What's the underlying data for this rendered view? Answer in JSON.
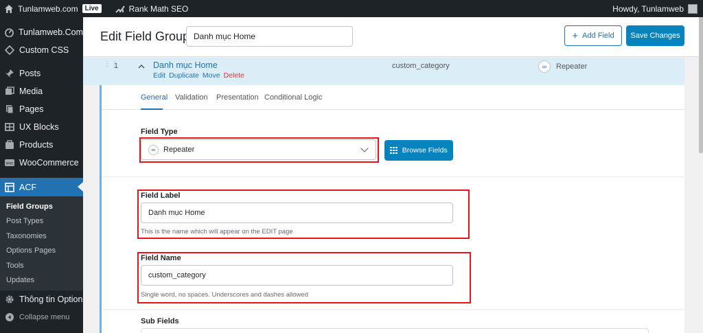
{
  "admin_bar": {
    "site_name": "Tunlamweb.com",
    "live_badge": "Live",
    "seo_plugin": "Rank Math SEO",
    "greeting": "Howdy, Tunlamweb"
  },
  "sidebar": {
    "items_top": [
      {
        "label": "Tunlamweb.Com",
        "icon": "dashboard-icon"
      },
      {
        "label": "Custom CSS",
        "icon": "diamond-icon"
      },
      {
        "label": "Posts",
        "icon": "pin-icon"
      },
      {
        "label": "Media",
        "icon": "media-icon"
      },
      {
        "label": "Pages",
        "icon": "pages-icon"
      },
      {
        "label": "UX Blocks",
        "icon": "blocks-icon"
      },
      {
        "label": "Products",
        "icon": "products-icon"
      },
      {
        "label": "WooCommerce",
        "icon": "woo-icon"
      }
    ],
    "acf": {
      "label": "ACF",
      "icon": "acf-icon"
    },
    "submenu": [
      "Field Groups",
      "Post Types",
      "Taxonomies",
      "Options Pages",
      "Tools",
      "Updates"
    ],
    "thong_tin": {
      "label": "Thông tin Option",
      "icon": "gear-icon"
    },
    "collapse": {
      "label": "Collapse menu",
      "icon": "collapse-icon"
    }
  },
  "header": {
    "title": "Edit Field Group",
    "group_title_value": "Danh mục Home",
    "add_field": "Add Field",
    "save_changes": "Save Changes"
  },
  "field_row": {
    "order": "1",
    "label": "Danh mục Home",
    "actions": {
      "edit": "Edit",
      "duplicate": "Duplicate",
      "move": "Move",
      "delete": "Delete"
    },
    "name": "custom_category",
    "type": "Repeater"
  },
  "tabs": [
    "General",
    "Validation",
    "Presentation",
    "Conditional Logic"
  ],
  "active_tab": "General",
  "field_type": {
    "label": "Field Type",
    "value": "Repeater",
    "browse": "Browse Fields"
  },
  "field_label": {
    "label": "Field Label",
    "value": "Danh mục Home",
    "hint": "This is the name which will appear on the EDIT page"
  },
  "field_name": {
    "label": "Field Name",
    "value": "custom_category",
    "hint": "Single word, no spaces. Underscores and dashes allowed"
  },
  "sub_fields": {
    "label": "Sub Fields"
  },
  "colors": {
    "admin_dark": "#1d2327",
    "accent": "#2271b1",
    "button_blue": "#0783be",
    "highlight_red": "#e5141b",
    "row_bg": "#dbeef8"
  }
}
